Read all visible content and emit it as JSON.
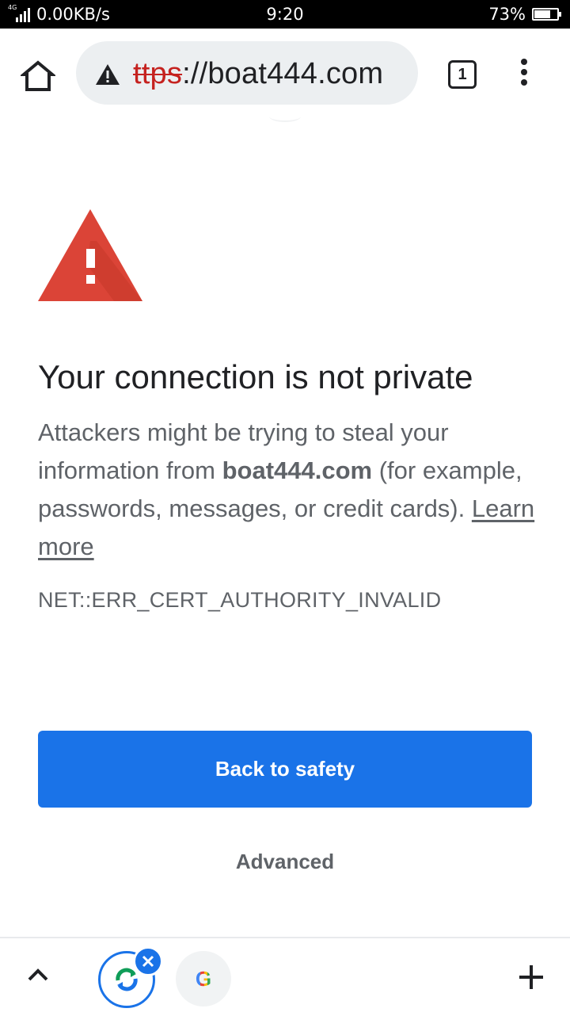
{
  "status_bar": {
    "network_type": "4G",
    "data_speed": "0.00KB/s",
    "time": "9:20",
    "battery_percent": "73%",
    "battery_level": 0.73
  },
  "toolbar": {
    "url_scheme": "ttps",
    "url_rest": "://boat444.com",
    "tab_count": "1"
  },
  "interstitial": {
    "heading": "Your connection is not private",
    "body_prefix": "Attackers might be trying to steal your information from ",
    "body_domain": "boat444.com",
    "body_suffix": " (for example, passwords, messages, or credit cards). ",
    "learn_more": "Learn more",
    "error_code": "NET::ERR_CERT_AUTHORITY_INVALID",
    "back_button": "Back to safety",
    "advanced_button": "Advanced"
  },
  "bottom_bar": {
    "google_label": "G"
  },
  "colors": {
    "accent": "#1a73e8",
    "warning_red": "#db4437",
    "text_primary": "#202124",
    "text_secondary": "#5f6368"
  }
}
